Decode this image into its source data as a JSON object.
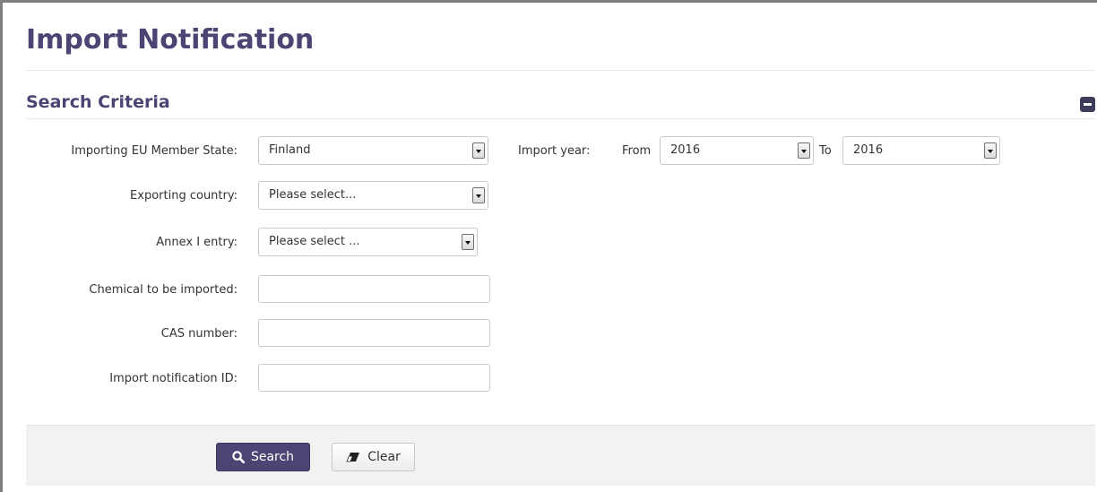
{
  "page": {
    "title": "Import Notification"
  },
  "section": {
    "title": "Search Criteria"
  },
  "form": {
    "member_state": {
      "label": "Importing EU Member State:",
      "value": "Finland"
    },
    "import_year": {
      "label": "Import year:",
      "from_label": "From",
      "from_value": "2016",
      "to_label": "To",
      "to_value": "2016"
    },
    "exporting_country": {
      "label": "Exporting country:",
      "value": "Please select..."
    },
    "annex_entry": {
      "label": "Annex I entry:",
      "value": "Please select ..."
    },
    "chemical": {
      "label": "Chemical to be imported:",
      "value": ""
    },
    "cas_number": {
      "label": "CAS number:",
      "value": ""
    },
    "notification_id": {
      "label": "Import notification ID:",
      "value": ""
    }
  },
  "buttons": {
    "search_label": "Search",
    "clear_label": "Clear"
  },
  "icons": {
    "collapse": "minus-square-icon",
    "search": "magnifier-icon",
    "clear": "eraser-icon"
  },
  "colors": {
    "brand": "#4a4573",
    "collapse_button": "#3d3c5a",
    "footer_background": "#f2f2f2"
  }
}
